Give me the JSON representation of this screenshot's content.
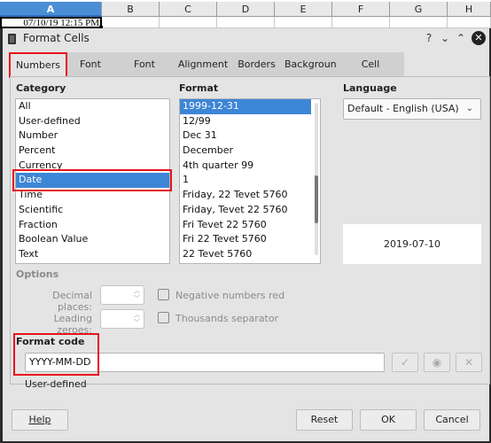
{
  "spreadsheet": {
    "columns": [
      "A",
      "B",
      "C",
      "D",
      "E",
      "F",
      "G",
      "H"
    ],
    "active_column": "A",
    "active_cell_value": "07/10/19 12:15 PM"
  },
  "dialog": {
    "title": "Format Cells",
    "title_controls": {
      "help": "?",
      "minimize": "⌄",
      "maximize": "⌃",
      "close": "✕"
    },
    "tabs": [
      {
        "label": "Numbers",
        "active": true
      },
      {
        "label": "Font",
        "active": false
      },
      {
        "label": "Font Effects",
        "active": false
      },
      {
        "label": "Alignment",
        "active": false
      },
      {
        "label": "Borders",
        "active": false
      },
      {
        "label": "Background",
        "active": false
      },
      {
        "label": "Cell Protection",
        "active": false
      }
    ],
    "category": {
      "label": "Category",
      "items": [
        "All",
        "User-defined",
        "Number",
        "Percent",
        "Currency",
        "Date",
        "Time",
        "Scientific",
        "Fraction",
        "Boolean Value",
        "Text"
      ],
      "selected": "Date"
    },
    "format": {
      "label": "Format",
      "items": [
        "1999-12-31",
        "12/99",
        "Dec 31",
        "December",
        "4th quarter 99",
        "1",
        "Friday, 22 Tevet 5760",
        "Friday, Tevet 22 5760",
        "Fri Tevet 22 5760",
        "Fri 22 Tevet 5760",
        "22 Tevet 5760"
      ],
      "selected": "1999-12-31"
    },
    "language": {
      "label": "Language",
      "value": "Default - English (USA)"
    },
    "preview": "2019-07-10",
    "options": {
      "label": "Options",
      "decimal_places_label": "Decimal places:",
      "decimal_places_value": "",
      "leading_zeroes_label": "Leading zeroes:",
      "leading_zeroes_value": "",
      "negative_red_label": "Negative numbers red",
      "negative_red_checked": false,
      "thousands_sep_label": "Thousands separator",
      "thousands_sep_checked": false
    },
    "format_code": {
      "label": "Format code",
      "value": "YYYY-MM-DD",
      "description": "User-defined",
      "accept_icon": "✓",
      "edit_comment_icon": "◉",
      "delete_icon": "✕"
    },
    "buttons": {
      "help": "Help",
      "reset": "Reset",
      "ok": "OK",
      "cancel": "Cancel"
    },
    "highlight_color": "#e8141b",
    "selection_color": "#3d86d6"
  }
}
